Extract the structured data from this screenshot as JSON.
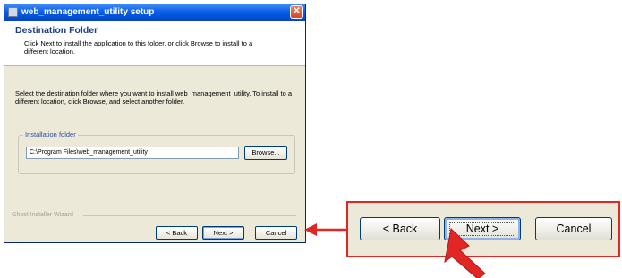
{
  "window": {
    "title": "web_management_utility setup",
    "close_glyph": "✕",
    "app_icon": "setup-icon"
  },
  "header": {
    "title": "Destination Folder",
    "description": "Click Next to install the application to this folder, or click Browse to install to a different location."
  },
  "body": {
    "instruction": "Select the destination folder where you want to install web_management_utility. To install to a different location, click Browse, and select another folder."
  },
  "install_folder": {
    "label": "Installation folder",
    "path": "C:\\Program Files\\web_management_utility",
    "browse_label": "Browse..."
  },
  "footer": {
    "wizard_label": "Ghost Installer Wizard",
    "back_label": "< Back",
    "next_label": "Next >",
    "cancel_label": "Cancel"
  },
  "callout": {
    "back_label": "< Back",
    "next_label": "Next >",
    "cancel_label": "Cancel"
  },
  "colors": {
    "accent_red": "#e02726",
    "titlebar_blue": "#0a5ee8",
    "header_title_blue": "#1e3d8f"
  }
}
